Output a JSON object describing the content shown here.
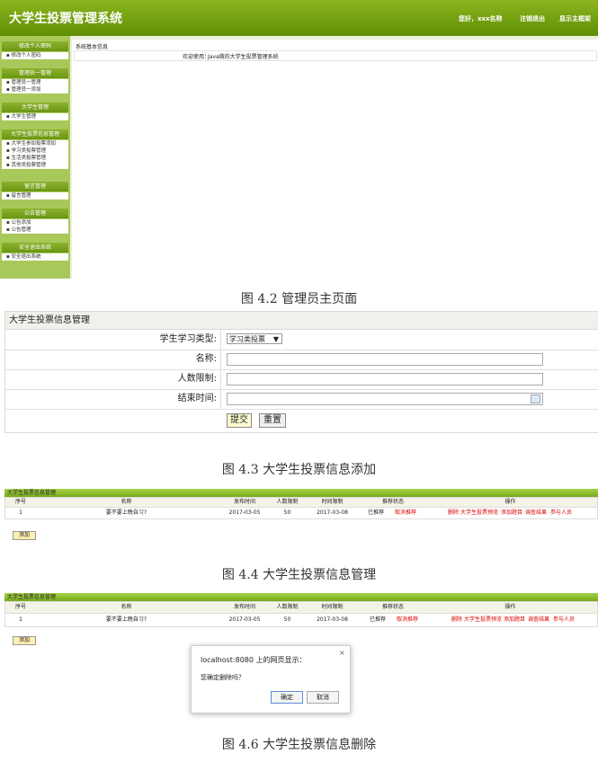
{
  "fig1": {
    "system_title": "大学生投票管理系统",
    "greeting": "您好，xxx名称",
    "logout": "注销退出",
    "show_main": "显示主框架",
    "sidebar": [
      {
        "title": "修改个人密码",
        "items": [
          "修改个人密码"
        ]
      },
      {
        "title": "管理员一管理",
        "items": [
          "管理员一管理",
          "管理员一添加"
        ]
      },
      {
        "title": "大学生管理",
        "items": [
          "大学生管理"
        ]
      },
      {
        "title": "大学生投票信息管理",
        "items": [
          "大学生参加投票添加",
          "学习类投票管理",
          "生活类投票管理",
          "其他类投票管理"
        ]
      },
      {
        "title": "留言管理",
        "items": [
          "留言管理"
        ]
      },
      {
        "title": "公告管理",
        "items": [
          "公告添加",
          "公告管理"
        ]
      },
      {
        "title": "安全退出系统",
        "items": [
          "安全退出系统"
        ]
      }
    ],
    "main_heading": "系统基本信息",
    "welcome_label": "欢迎使用：",
    "welcome_text": "Java做的大学生投票管理系统",
    "caption": "图 4.2 管理员主页面"
  },
  "fig2": {
    "header": "大学生投票信息管理",
    "type_label": "学生学习类型:",
    "type_value": "学习类投票",
    "name_label": "名称:",
    "limit_label": "人数限制:",
    "end_label": "结束时间:",
    "submit": "提交",
    "reset": "重置",
    "caption": "图 4.3 大学生投票信息添加"
  },
  "fig3": {
    "header": "大学生投票信息管理",
    "columns": [
      "序号",
      "名称",
      "发布时间",
      "人数限制",
      "时间限制",
      "推荐状态",
      "操作"
    ],
    "row": {
      "index": "1",
      "name": "要不要上晚自习?",
      "publish": "2017-03-05",
      "limit": "50",
      "deadline": "2017-03-08",
      "status": "已推荐",
      "cancel": "取消推荐",
      "ops": [
        "删除",
        "大学生投票预览",
        "添加题目",
        "调查结果",
        "参与人员"
      ]
    },
    "add": "添加",
    "caption": "图 4.4 大学生投票信息管理"
  },
  "fig4": {
    "caption": "图 4.6 大学生投票信息删除",
    "dialog": {
      "title": "localhost:8080 上的网页显示：",
      "message": "您确定删除吗？",
      "ok": "确定",
      "cancel": "取消",
      "close": "×"
    }
  }
}
